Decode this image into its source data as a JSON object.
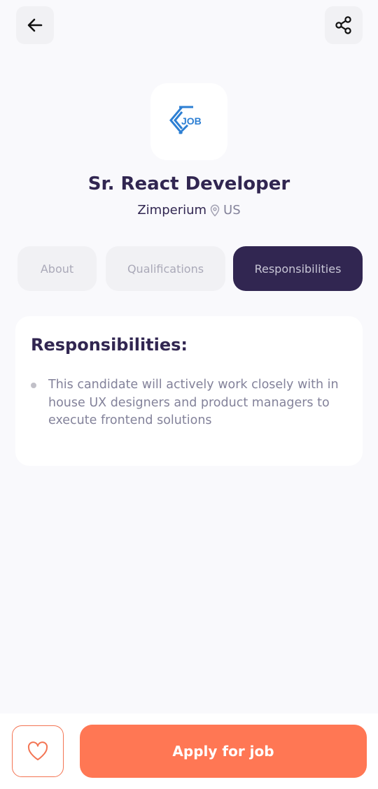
{
  "header": {
    "back_icon": "arrow-left-icon",
    "share_icon": "share-icon"
  },
  "job": {
    "logo_text": "JOB",
    "title": "Sr. React Developer",
    "company": "Zimperium",
    "location_icon": "location-pin-icon",
    "location": "US"
  },
  "tabs": [
    {
      "label": "About",
      "active": false
    },
    {
      "label": "Qualifications",
      "active": false
    },
    {
      "label": "Responsibilities",
      "active": true
    }
  ],
  "section": {
    "heading": "Responsibilities:",
    "points": [
      "This candidate will actively work closely with in house UX designers and product managers to execute frontend solutions"
    ]
  },
  "footer": {
    "like_icon": "heart-outline-icon",
    "apply_label": "Apply for job"
  },
  "colors": {
    "background": "#F9F9FC",
    "primary_dark": "#312651",
    "accent": "#FF7754",
    "muted_text": "#83829A",
    "logo_blue": "#2D7FD3"
  }
}
